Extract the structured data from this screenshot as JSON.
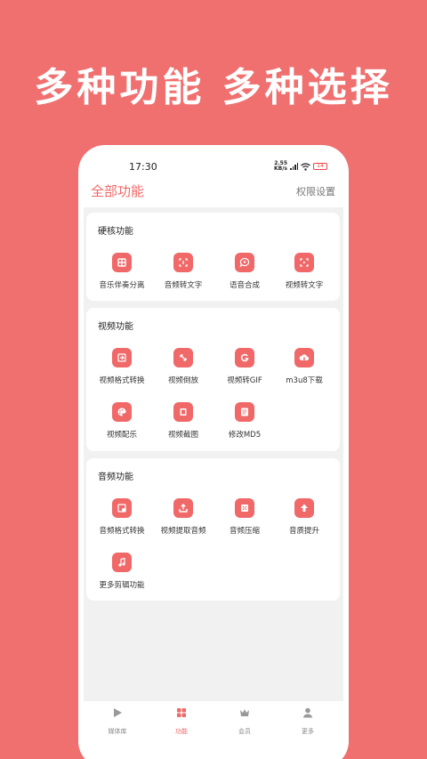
{
  "headline": "多种功能  多种选择",
  "status_bar": {
    "time": "17:30",
    "net_speed_value": "2.55",
    "net_speed_unit": "KB/s",
    "battery": "14"
  },
  "app_bar": {
    "title": "全部功能",
    "right_link": "权限设置"
  },
  "sections": [
    {
      "title": "硬核功能",
      "items": [
        {
          "label": "音乐伴奏分离",
          "icon": "music-separate-icon"
        },
        {
          "label": "音频转文字",
          "icon": "audio-to-text-icon"
        },
        {
          "label": "语音合成",
          "icon": "speech-synthesis-icon"
        },
        {
          "label": "视频转文字",
          "icon": "video-to-text-icon"
        }
      ]
    },
    {
      "title": "视频功能",
      "items": [
        {
          "label": "视频格式转换",
          "icon": "video-convert-icon"
        },
        {
          "label": "视频倒放",
          "icon": "video-reverse-icon"
        },
        {
          "label": "视频转GIF",
          "icon": "gif-icon"
        },
        {
          "label": "m3u8下载",
          "icon": "cloud-download-icon"
        },
        {
          "label": "视频配乐",
          "icon": "palette-icon"
        },
        {
          "label": "视频截图",
          "icon": "screenshot-icon"
        },
        {
          "label": "修改MD5",
          "icon": "md5-icon"
        }
      ]
    },
    {
      "title": "音频功能",
      "items": [
        {
          "label": "音频格式转换",
          "icon": "audio-convert-icon"
        },
        {
          "label": "视频提取音频",
          "icon": "extract-audio-icon"
        },
        {
          "label": "音频压缩",
          "icon": "compress-icon"
        },
        {
          "label": "音质提升",
          "icon": "quality-up-icon"
        },
        {
          "label": "更多剪辑功能",
          "icon": "music-note-icon"
        }
      ]
    }
  ],
  "tabs": [
    {
      "label": "媒体库",
      "icon": "play-icon",
      "active": false
    },
    {
      "label": "功能",
      "icon": "grid-icon",
      "active": true
    },
    {
      "label": "会员",
      "icon": "crown-icon",
      "active": false
    },
    {
      "label": "更多",
      "icon": "person-icon",
      "active": false
    }
  ],
  "colors": {
    "background": "#f07070",
    "accent": "#f06868",
    "content_bg": "#f1f1f1"
  }
}
